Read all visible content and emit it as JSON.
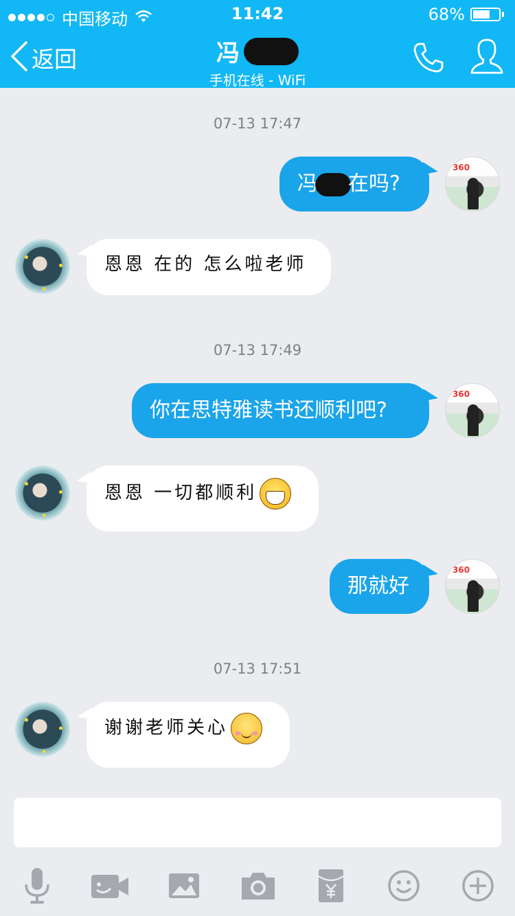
{
  "status_bar": {
    "carrier": "中国移动",
    "time": "11:42",
    "battery_percent": "68%",
    "battery_level": 0.68
  },
  "header": {
    "back_label": "返回",
    "contact_name": "冯",
    "contact_status": "手机在线 - WiFi"
  },
  "messages": [
    {
      "type": "timestamp",
      "text": "07-13 17:47"
    },
    {
      "type": "out",
      "before": "冯",
      "after": "在吗?"
    },
    {
      "type": "in",
      "text": "恩恩 在的 怎么啦老师"
    },
    {
      "type": "timestamp",
      "text": "07-13 17:49"
    },
    {
      "type": "out",
      "text": "你在思特雅读书还顺利吧?"
    },
    {
      "type": "in",
      "text": "恩恩 一切都顺利",
      "emoji": "grin-emoji"
    },
    {
      "type": "out",
      "text": "那就好"
    },
    {
      "type": "timestamp",
      "text": "07-13 17:51"
    },
    {
      "type": "in",
      "text": "谢谢老师关心",
      "emoji": "smile-emoji"
    }
  ],
  "teacher_avatar_logo": "360",
  "input": {
    "value": "",
    "placeholder": ""
  },
  "toolbar": {
    "icons": [
      "microphone-icon",
      "video-icon",
      "image-icon",
      "camera-icon",
      "red-packet-icon",
      "emoji-icon",
      "plus-icon"
    ]
  },
  "colors": {
    "header": "#12b7f5",
    "outgoing_bubble": "#1aa4ea",
    "incoming_bubble": "#ffffff",
    "background": "#ebecf0",
    "toolbar_icon": "#a5a8ae"
  }
}
